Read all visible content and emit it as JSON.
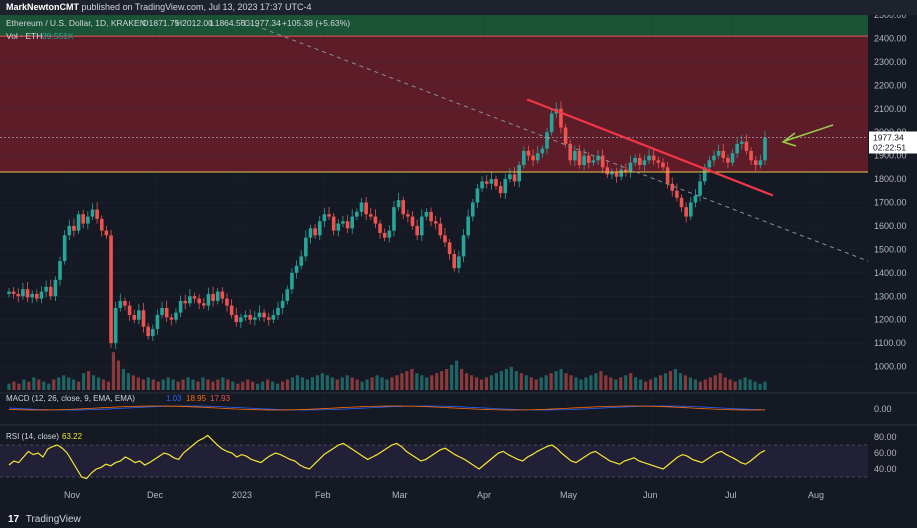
{
  "header": {
    "publisher": "MarkNewtonCMT",
    "published_text": "published on TradingView.com, Jul 13, 2023 17:37 UTC-4"
  },
  "legend": {
    "symbol": "Ethereum / U.S. Dollar, 1D, KRAKEN",
    "o_label": "O",
    "o_val": "1871.75",
    "h_label": "H",
    "h_val": "2012.00",
    "l_label": "L",
    "l_val": "1864.56",
    "c_label": "C",
    "c_val": "1977.34",
    "change": "+105.38 (+5.63%)",
    "vol_label": "Vol · ETH",
    "vol_val": "39.551K"
  },
  "macd": {
    "label": "MACD (12, 26, close, 9, EMA, EMA)",
    "v1": "1.03",
    "v2": "18.95",
    "v3": "17.93"
  },
  "rsi": {
    "label": "RSI (14, close)",
    "value": "63.22"
  },
  "price_label": {
    "price": "1977.34",
    "countdown": "02:22:51"
  },
  "footer": {
    "brand": "TradingView"
  },
  "colors": {
    "up": "#26a69a",
    "down": "#ef5350",
    "bg": "#151924",
    "zone": "#6b1d2a",
    "zone_top": "#1b5e3a",
    "rsi": "#f5e632",
    "trend": "#f23645"
  },
  "chart_data": {
    "type": "candlestick",
    "price_ticks": [
      1000,
      1100,
      1200,
      1300,
      1400,
      1500,
      1600,
      1700,
      1800,
      1900,
      2000,
      2100,
      2200,
      2300,
      2400,
      2500
    ],
    "price_range": [
      900,
      2500
    ],
    "macd_ticks": [
      "0.00"
    ],
    "rsi_ticks": [
      "80.00",
      "60.00",
      "40.00"
    ],
    "x_labels": [
      "Nov",
      "Dec",
      "2023",
      "Feb",
      "Mar",
      "Apr",
      "May",
      "Jun",
      "Jul",
      "Aug"
    ],
    "resistance_zone": [
      1830,
      2410
    ],
    "horizontal_line": 1830,
    "close_line": 1977.34,
    "trendline": {
      "from": [
        "Apr 16",
        2140
      ],
      "to": [
        "Jul 18",
        1730
      ]
    },
    "dashed_trendline": {
      "from": [
        "Jan 30",
        2480
      ],
      "to": [
        "Aug 25",
        1450
      ]
    },
    "closes": [
      1320,
      1310,
      1300,
      1330,
      1295,
      1310,
      1290,
      1320,
      1340,
      1300,
      1370,
      1450,
      1560,
      1600,
      1580,
      1650,
      1610,
      1640,
      1670,
      1630,
      1580,
      1560,
      1100,
      1250,
      1280,
      1260,
      1220,
      1200,
      1240,
      1170,
      1130,
      1160,
      1220,
      1250,
      1210,
      1200,
      1230,
      1280,
      1270,
      1300,
      1290,
      1270,
      1260,
      1310,
      1280,
      1320,
      1290,
      1260,
      1220,
      1190,
      1210,
      1220,
      1200,
      1210,
      1230,
      1210,
      1200,
      1220,
      1250,
      1280,
      1330,
      1400,
      1430,
      1470,
      1550,
      1590,
      1560,
      1620,
      1650,
      1640,
      1580,
      1610,
      1620,
      1590,
      1640,
      1660,
      1700,
      1650,
      1640,
      1610,
      1570,
      1550,
      1580,
      1680,
      1710,
      1650,
      1640,
      1600,
      1560,
      1640,
      1660,
      1620,
      1610,
      1560,
      1530,
      1480,
      1420,
      1470,
      1560,
      1640,
      1700,
      1760,
      1790,
      1780,
      1800,
      1770,
      1740,
      1800,
      1820,
      1790,
      1860,
      1920,
      1900,
      1880,
      1910,
      1930,
      2000,
      2080,
      2100,
      2020,
      1950,
      1880,
      1920,
      1860,
      1900,
      1870,
      1880,
      1900,
      1850,
      1820,
      1830,
      1810,
      1840,
      1830,
      1870,
      1890,
      1860,
      1880,
      1900,
      1880,
      1870,
      1850,
      1780,
      1750,
      1720,
      1680,
      1640,
      1700,
      1730,
      1790,
      1850,
      1880,
      1900,
      1920,
      1890,
      1870,
      1910,
      1950,
      1960,
      1920,
      1880,
      1860,
      1880,
      1977.34
    ],
    "rsi_series": [
      45,
      50,
      48,
      55,
      62,
      58,
      60,
      55,
      65,
      68,
      70,
      66,
      60,
      50,
      40,
      30,
      28,
      35,
      40,
      42,
      46,
      44,
      48,
      50,
      55,
      52,
      48,
      50,
      45,
      48,
      52,
      56,
      60,
      58,
      54,
      52,
      60,
      65,
      70,
      75,
      78,
      82,
      76,
      70,
      65,
      62,
      60,
      55,
      58,
      56,
      52,
      50,
      48,
      53,
      57,
      60,
      58,
      55,
      52,
      50,
      45,
      42,
      40,
      46,
      52,
      58,
      62,
      66,
      70,
      72,
      68,
      64,
      60,
      56,
      52,
      55,
      58,
      62,
      66,
      70,
      72,
      68,
      62,
      58,
      54,
      50,
      52,
      56,
      60,
      64,
      66,
      62,
      58,
      55,
      52,
      48,
      44,
      40,
      45,
      50,
      55,
      60,
      62,
      58,
      55,
      52,
      50,
      55,
      58,
      62,
      65,
      68,
      70,
      66,
      60,
      55,
      50,
      48,
      52,
      56,
      60,
      62,
      58,
      54,
      50,
      48,
      46,
      50,
      52,
      54,
      50,
      48,
      46,
      44,
      42,
      40,
      45,
      50,
      55,
      58,
      56,
      52,
      50,
      48,
      52,
      56,
      60,
      62,
      58,
      55,
      52,
      48,
      46,
      50,
      55,
      60,
      63.22
    ],
    "volume_series": [
      3,
      4,
      3,
      5,
      4,
      6,
      5,
      4,
      3,
      5,
      6,
      7,
      6,
      5,
      4,
      8,
      9,
      7,
      6,
      5,
      4,
      18,
      14,
      10,
      8,
      7,
      6,
      5,
      6,
      5,
      4,
      5,
      6,
      5,
      4,
      5,
      6,
      5,
      4,
      6,
      5,
      4,
      5,
      6,
      5,
      4,
      3,
      4,
      5,
      4,
      3,
      4,
      5,
      4,
      3,
      4,
      5,
      6,
      7,
      6,
      5,
      6,
      7,
      8,
      7,
      6,
      5,
      6,
      7,
      6,
      5,
      4,
      5,
      6,
      7,
      6,
      5,
      6,
      7,
      8,
      9,
      10,
      8,
      7,
      6,
      7,
      8,
      9,
      10,
      12,
      14,
      10,
      8,
      7,
      6,
      5,
      6,
      7,
      8,
      9,
      10,
      11,
      9,
      8,
      7,
      6,
      5,
      6,
      7,
      8,
      9,
      10,
      8,
      7,
      6,
      5,
      6,
      7,
      8,
      9,
      7,
      6,
      5,
      6,
      7,
      8,
      6,
      5,
      4,
      5,
      6,
      7,
      8,
      9,
      10,
      8,
      7,
      6,
      5,
      4,
      5,
      6,
      7,
      8,
      6,
      5,
      4,
      5,
      6,
      5,
      4,
      3,
      4
    ]
  }
}
